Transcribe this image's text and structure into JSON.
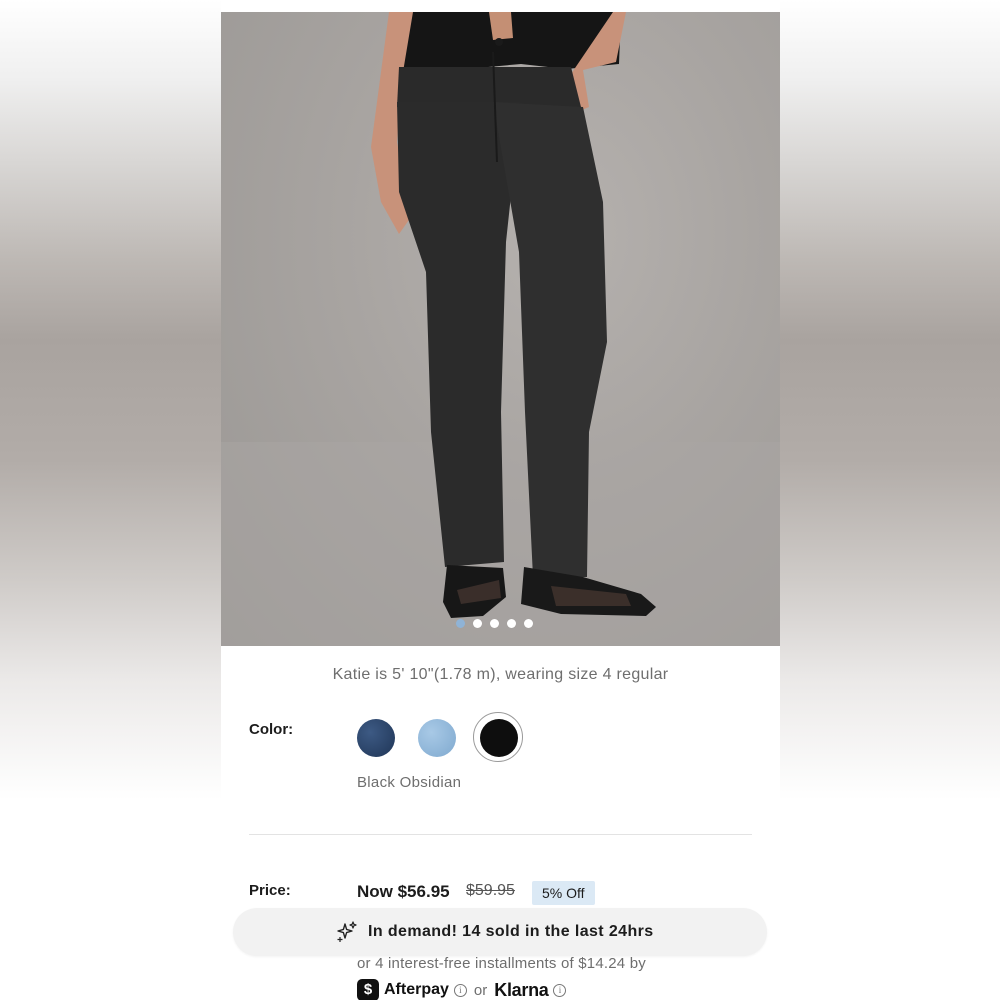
{
  "product": {
    "model_caption": "Katie is 5' 10\"(1.78 m), wearing size 4 regular",
    "color_label": "Color:",
    "selected_color_name": "Black Obsidian",
    "colors": [
      {
        "name": "Dark Blue",
        "hex": "#2a4368"
      },
      {
        "name": "Light Blue",
        "hex": "#93b9dc"
      },
      {
        "name": "Black Obsidian",
        "hex": "#0e0e0e",
        "selected": true
      }
    ],
    "carousel": {
      "total": 5,
      "active": 1
    }
  },
  "pricing": {
    "label": "Price:",
    "now": "Now $56.95",
    "was": "$59.95",
    "discount_badge": "5% Off"
  },
  "demand_banner": {
    "icon": "sparkle-icon",
    "text": "In demand! 14 sold in the last 24hrs"
  },
  "installments": {
    "text": "or 4 interest-free installments of $14.24 by",
    "afterpay_label": "Afterpay",
    "or_text": "or",
    "klarna_label": "Klarna",
    "info_glyph": "i",
    "afterpay_glyph": "$"
  },
  "colors": {
    "badge_bg": "#dbe9f5",
    "dot_active": "#8fb3d6",
    "banner_bg": "#f2f2f2"
  }
}
